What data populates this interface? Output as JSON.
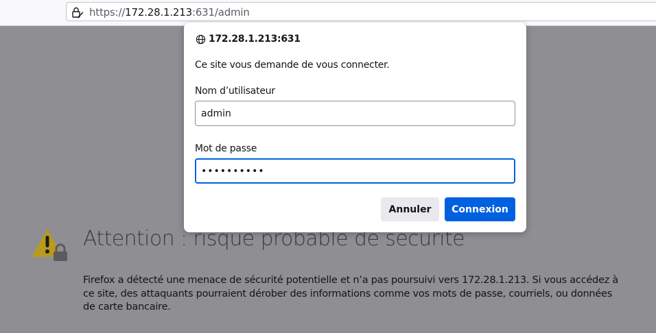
{
  "urlbar": {
    "scheme": "https://",
    "host": "172.28.1.213",
    "rest": ":631/admin"
  },
  "page": {
    "heading": "Attention : risque probable de sécurité",
    "paragraph": "Firefox a détecté une menace de sécurité potentielle et n’a pas poursuivi vers 172.28.1.213. Si vous accédez à ce site, des attaquants pourraient dérober des informations comme vos mots de passe, courriels, ou données de carte bancaire."
  },
  "dialog": {
    "host": "172.28.1.213:631",
    "message": "Ce site vous demande de vous connecter.",
    "username_label": "Nom d’utilisateur",
    "username_value": "admin",
    "password_label": "Mot de passe",
    "password_value": "••••••••••",
    "cancel_label": "Annuler",
    "connect_label": "Connexion"
  },
  "icons": {
    "lock": "lock-warning-icon",
    "star": "bookmark-star-icon",
    "globe": "globe-icon",
    "warning": "warning-triangle-icon"
  },
  "colors": {
    "accent": "#0061e0",
    "overlay": "#8e8e93",
    "warning_yellow": "#ffbf00"
  }
}
